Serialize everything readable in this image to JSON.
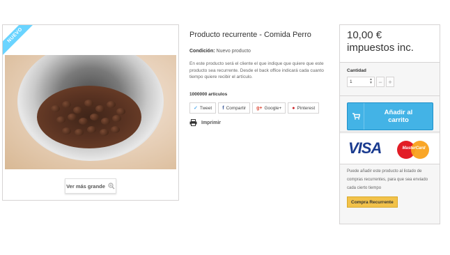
{
  "product": {
    "badge": "NUEVO",
    "zoom_label": "Ver más grande",
    "title": "Producto recurrente - Comida Perro",
    "condition_label": "Condición:",
    "condition_value": "Nuevo producto",
    "description": "En este producto será el cliente el que indique que quiere que este producto sea recurrente. Desde el back office indicará cada cuanto tiempo quiere recibir el artículo.",
    "stock": "1000000 artículos"
  },
  "social": {
    "tweet": "Tweet",
    "share": "Compartir",
    "googleplus": "Google+",
    "pinterest": "Pinterest"
  },
  "print_label": "Imprimir",
  "buy_box": {
    "price_line1": "10,00 €",
    "price_line2": "impuestos inc.",
    "quantity_label": "Cantidad",
    "quantity_value": "1",
    "minus": "−",
    "plus": "+",
    "add_to_cart_line1": "Añadir al",
    "add_to_cart_line2": "carrito",
    "visa": "VISA",
    "mastercard": "MasterCard",
    "recurring_text": "Puede añadir este producto al listado de compras recurrentes, para que sea enviado cada cierto tiempo",
    "recurring_button": "Compra Recurrente"
  },
  "colors": {
    "accent": "#43b3e6",
    "ribbon": "#6ad4ff",
    "recurring_button": "#f2c24a",
    "pinterest": "#cb2027",
    "twitter": "#55acee",
    "googleplus": "#dd4b39"
  },
  "icons": {
    "zoom": "magnify-plus-icon",
    "print": "printer-icon",
    "cart": "shopping-cart-icon",
    "stepper": "spinner-arrows-icon"
  }
}
